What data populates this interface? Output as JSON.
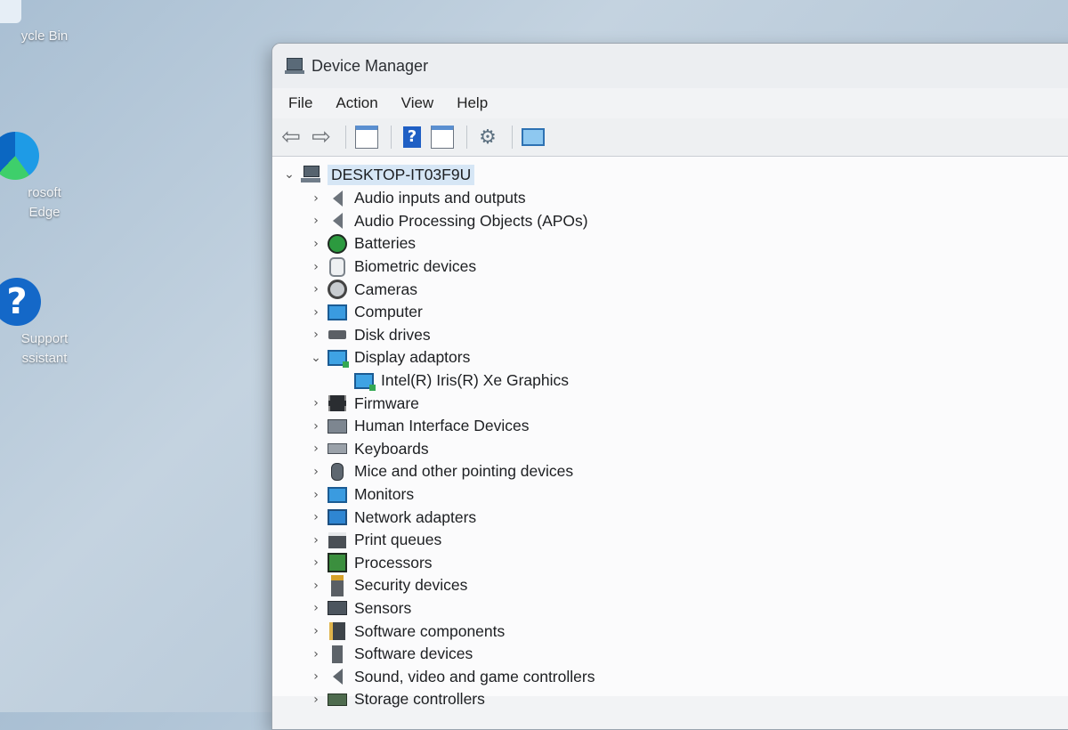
{
  "desktop": {
    "icons": [
      {
        "label": "ycle Bin",
        "icon": "recycle-bin-icon"
      },
      {
        "label": "rosoft\nEdge",
        "icon": "edge-icon"
      },
      {
        "label": "Support\nssistant",
        "icon": "support-assistant-icon"
      }
    ]
  },
  "window": {
    "title": "Device Manager",
    "menu": [
      "File",
      "Action",
      "View",
      "Help"
    ],
    "toolbar": [
      "back-icon",
      "forward-icon",
      "properties-icon",
      "help-icon",
      "update-driver-icon",
      "scan-hardware-icon",
      "monitor-scan-icon"
    ]
  },
  "tree": {
    "root": "DESKTOP-IT03F9U",
    "nodes": [
      {
        "label": "Audio inputs and outputs",
        "icon": "speaker-icon",
        "expanded": false
      },
      {
        "label": "Audio Processing Objects (APOs)",
        "icon": "speaker-icon",
        "expanded": false
      },
      {
        "label": "Batteries",
        "icon": "battery-icon",
        "expanded": false
      },
      {
        "label": "Biometric devices",
        "icon": "fingerprint-icon",
        "expanded": false
      },
      {
        "label": "Cameras",
        "icon": "camera-icon",
        "expanded": false
      },
      {
        "label": "Computer",
        "icon": "computer-icon",
        "expanded": false
      },
      {
        "label": "Disk drives",
        "icon": "disk-drive-icon",
        "expanded": false
      },
      {
        "label": "Display adaptors",
        "icon": "display-adaptor-icon",
        "expanded": true,
        "children": [
          {
            "label": "Intel(R) Iris(R) Xe Graphics",
            "icon": "display-adaptor-icon"
          }
        ]
      },
      {
        "label": "Firmware",
        "icon": "firmware-chip-icon",
        "expanded": false
      },
      {
        "label": "Human Interface Devices",
        "icon": "hid-icon",
        "expanded": false
      },
      {
        "label": "Keyboards",
        "icon": "keyboard-icon",
        "expanded": false
      },
      {
        "label": "Mice and other pointing devices",
        "icon": "mouse-icon",
        "expanded": false
      },
      {
        "label": "Monitors",
        "icon": "monitor-icon",
        "expanded": false
      },
      {
        "label": "Network adapters",
        "icon": "network-adapter-icon",
        "expanded": false
      },
      {
        "label": "Print queues",
        "icon": "printer-icon",
        "expanded": false
      },
      {
        "label": "Processors",
        "icon": "processor-icon",
        "expanded": false
      },
      {
        "label": "Security devices",
        "icon": "security-device-icon",
        "expanded": false
      },
      {
        "label": "Sensors",
        "icon": "sensor-icon",
        "expanded": false
      },
      {
        "label": "Software components",
        "icon": "software-component-icon",
        "expanded": false
      },
      {
        "label": "Software devices",
        "icon": "software-device-icon",
        "expanded": false
      },
      {
        "label": "Sound, video and game controllers",
        "icon": "sound-controller-icon",
        "expanded": false
      },
      {
        "label": "Storage controllers",
        "icon": "storage-controller-icon",
        "expanded": false
      }
    ]
  }
}
